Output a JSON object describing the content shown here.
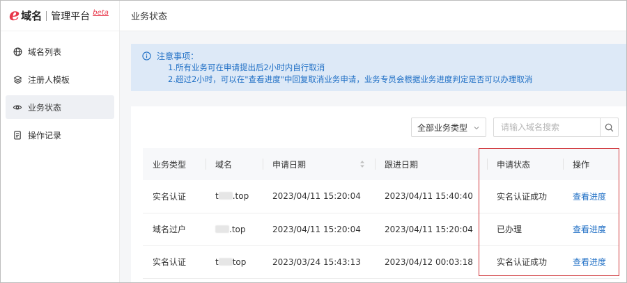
{
  "brand": {
    "logo_letter": "e",
    "name": "域名",
    "subtitle": "管理平台",
    "badge": "beta"
  },
  "sidebar": {
    "items": [
      {
        "label": "域名列表",
        "icon": "globe-icon",
        "active": false
      },
      {
        "label": "注册人模板",
        "icon": "layers-icon",
        "active": false
      },
      {
        "label": "业务状态",
        "icon": "eye-icon",
        "active": true
      },
      {
        "label": "操作记录",
        "icon": "document-icon",
        "active": false
      }
    ]
  },
  "header": {
    "title": "业务状态"
  },
  "notice": {
    "title": "注意事项：",
    "lines": [
      "1.所有业务可在申请提出后2小时内自行取消",
      "2.超过2小时，可以在\"查看进度\"中回复取消业务申请，业务专员会根据业务进度判定是否可以办理取消"
    ]
  },
  "filters": {
    "type_select": "全部业务类型",
    "search_placeholder": "请输入域名搜索"
  },
  "table": {
    "columns": [
      "业务类型",
      "域名",
      "申请日期",
      "跟进日期",
      "申请状态",
      "操作"
    ],
    "rows": [
      {
        "type": "实名认证",
        "domain_prefix": "t",
        "domain_suffix": ".top",
        "apply_date": "2023/04/11 15:20:04",
        "follow_date": "2023/04/11 15:40:40",
        "status": "实名认证成功",
        "action": "查看进度"
      },
      {
        "type": "域名过户",
        "domain_prefix": "",
        "domain_suffix": ".top",
        "apply_date": "2023/04/11 15:20:04",
        "follow_date": "2023/04/11 15:20:04",
        "status": "已办理",
        "action": "查看进度"
      },
      {
        "type": "实名认证",
        "domain_prefix": "t",
        "domain_suffix": "top",
        "apply_date": "2023/03/24 15:43:13",
        "follow_date": "2023/04/12 00:03:18",
        "status": "实名认证成功",
        "action": "查看进度"
      }
    ]
  },
  "colors": {
    "brand_red": "#e8374a",
    "link_blue": "#1f6fc5",
    "notice_bg": "#dde9f7",
    "highlight_red": "#d0363b"
  }
}
